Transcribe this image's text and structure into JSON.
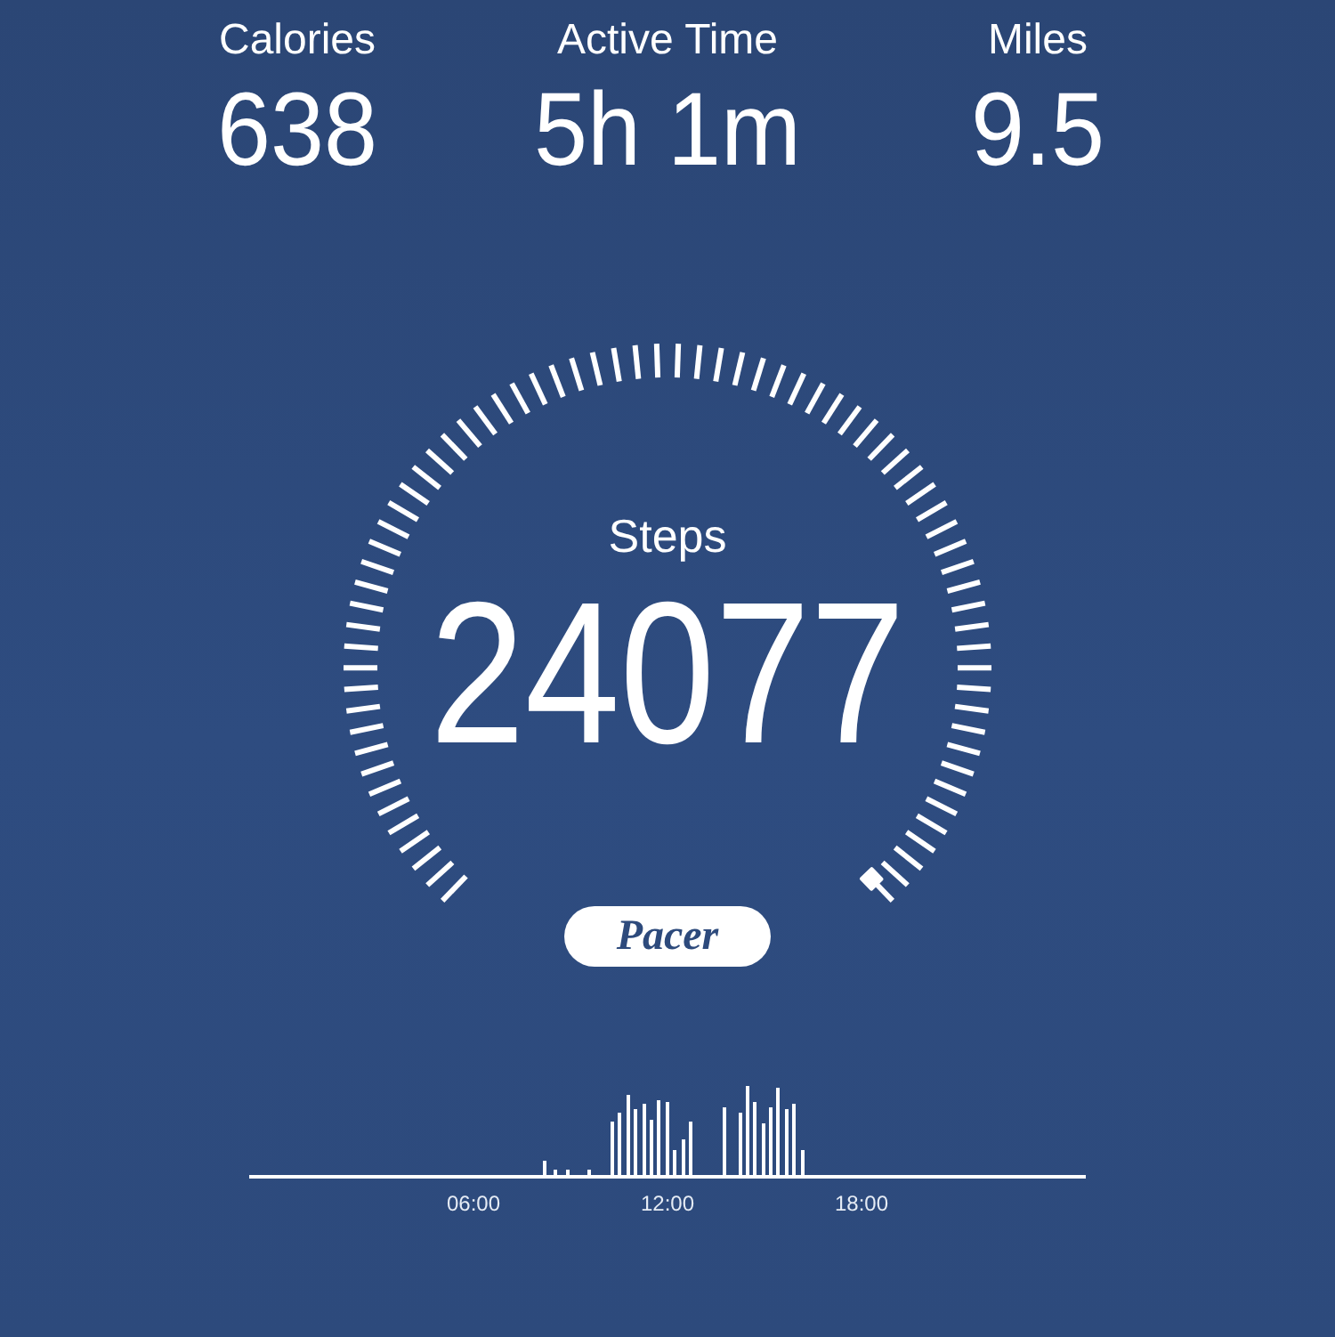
{
  "stats": [
    {
      "label": "Calories",
      "value": "638"
    },
    {
      "label": "Active Time",
      "value": "5h 1m"
    },
    {
      "label": "Miles",
      "value": "9.5"
    }
  ],
  "gauge": {
    "label": "Steps",
    "value": "24077"
  },
  "brand": "Pacer",
  "timeline": {
    "ticks": [
      "06:00",
      "12:00",
      "18:00"
    ]
  }
}
